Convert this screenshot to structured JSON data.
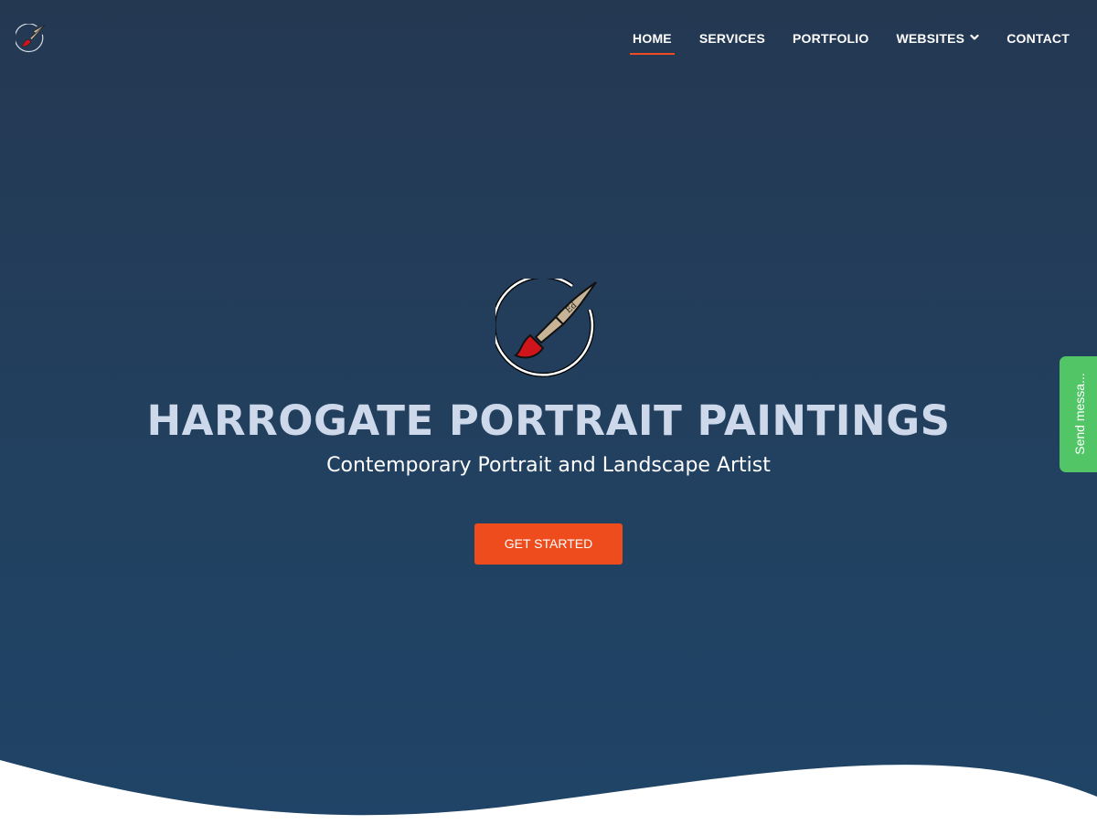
{
  "nav": {
    "logo_icon": "paintbrush-logo-icon",
    "items": [
      {
        "label": "HOME",
        "active": true
      },
      {
        "label": "SERVICES",
        "active": false
      },
      {
        "label": "PORTFOLIO",
        "active": false
      },
      {
        "label": "WEBSITES",
        "active": false,
        "dropdown": true
      },
      {
        "label": "CONTACT",
        "active": false
      }
    ]
  },
  "hero": {
    "logo_icon": "paintbrush-logo-icon",
    "logo_initials": "Ed",
    "title": "HARROGATE PORTRAIT PAINTINGS",
    "subtitle": "Contemporary Portrait and Landscape Artist",
    "cta_label": "GET STARTED"
  },
  "feedback_tab": {
    "label": "Send messa..."
  },
  "colors": {
    "hero_background": "#22405f",
    "accent": "#ee4c1d",
    "title": "#cdd9ea",
    "feedback_tab": "#52c567"
  }
}
